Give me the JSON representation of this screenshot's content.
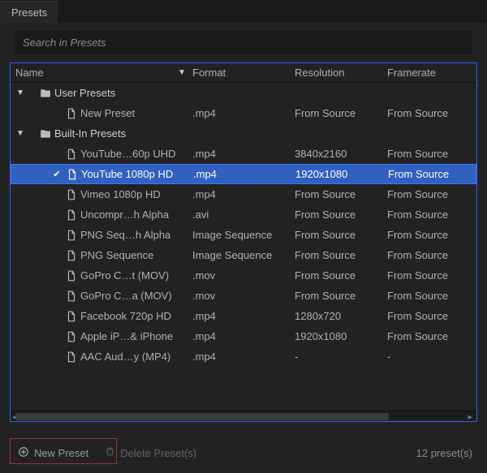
{
  "tab": {
    "title": "Presets"
  },
  "search": {
    "placeholder": "Search in Presets"
  },
  "columns": {
    "name": "Name",
    "format": "Format",
    "resolution": "Resolution",
    "framerate": "Framerate"
  },
  "groups": {
    "user": "User Presets",
    "builtin": "Built-In Presets"
  },
  "rows": [
    {
      "label": "New Preset",
      "format": ".mp4",
      "resolution": "From Source",
      "framerate": "From Source"
    },
    {
      "label": "YouTube…60p UHD",
      "format": ".mp4",
      "resolution": "3840x2160",
      "framerate": "From Source"
    },
    {
      "label": "YouTube 1080p HD",
      "format": ".mp4",
      "resolution": "1920x1080",
      "framerate": "From Source"
    },
    {
      "label": "Vimeo 1080p HD",
      "format": ".mp4",
      "resolution": "From Source",
      "framerate": "From Source"
    },
    {
      "label": "Uncompr…h Alpha",
      "format": ".avi",
      "resolution": "From Source",
      "framerate": "From Source"
    },
    {
      "label": "PNG Seq…h Alpha",
      "format": "Image Sequence",
      "resolution": "From Source",
      "framerate": "From Source"
    },
    {
      "label": "PNG Sequence",
      "format": "Image Sequence",
      "resolution": "From Source",
      "framerate": "From Source"
    },
    {
      "label": "GoPro C…t (MOV)",
      "format": ".mov",
      "resolution": "From Source",
      "framerate": "From Source"
    },
    {
      "label": "GoPro C…a (MOV)",
      "format": ".mov",
      "resolution": "From Source",
      "framerate": "From Source"
    },
    {
      "label": "Facebook 720p HD",
      "format": ".mp4",
      "resolution": "1280x720",
      "framerate": "From Source"
    },
    {
      "label": "Apple iP…& iPhone",
      "format": ".mp4",
      "resolution": "1920x1080",
      "framerate": "From Source"
    },
    {
      "label": "AAC Aud…y (MP4)",
      "format": ".mp4",
      "resolution": "-",
      "framerate": "-"
    }
  ],
  "footer": {
    "new": "New Preset",
    "delete": "Delete Preset(s)",
    "count": "12 preset(s)"
  }
}
